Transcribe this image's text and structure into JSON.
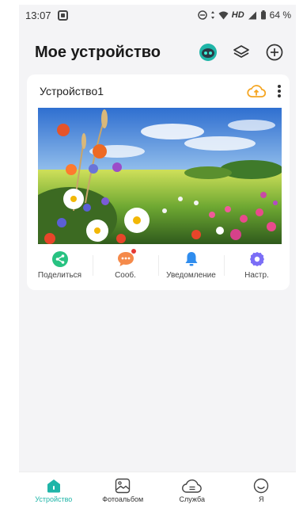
{
  "status_bar": {
    "time": "13:07",
    "network": "HD",
    "battery": "64 %"
  },
  "header": {
    "title": "Мое устройство"
  },
  "device_card": {
    "name": "Устройство1",
    "actions": [
      {
        "label": "Поделиться",
        "icon": "share-icon",
        "color": "#27c281"
      },
      {
        "label": "Сооб.",
        "icon": "message-icon",
        "color": "#f58a4a"
      },
      {
        "label": "Уведомление",
        "icon": "bell-icon",
        "color": "#2f8dee"
      },
      {
        "label": "Настр.",
        "icon": "settings-icon",
        "color": "#7b6ef6"
      }
    ]
  },
  "bottom_nav": {
    "items": [
      {
        "label": "Устройство",
        "icon": "device-icon",
        "active": true
      },
      {
        "label": "Фотоальбом",
        "icon": "photo-album-icon",
        "active": false
      },
      {
        "label": "Служба",
        "icon": "service-icon",
        "active": false
      },
      {
        "label": "Я",
        "icon": "profile-icon",
        "active": false
      }
    ]
  },
  "colors": {
    "accent": "#1fb5a8",
    "upload": "#f5a623",
    "background": "#f4f4f6"
  }
}
